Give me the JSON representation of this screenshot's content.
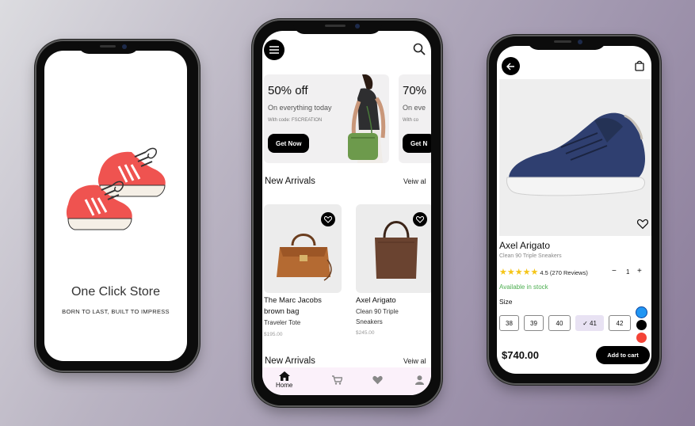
{
  "splash": {
    "store_name": "One Click Store",
    "tagline": "BORN TO LAST, BUILT TO IMPRESS"
  },
  "home": {
    "promos": [
      {
        "title": "50% off",
        "subtitle": "On everything today",
        "code": "With code: FSCREATION",
        "button": "Get Now"
      },
      {
        "title": "70%",
        "subtitle": "On eve",
        "code": "With co",
        "button": "Get N"
      }
    ],
    "section1": {
      "title": "New Arrivals",
      "link": "Veiw al"
    },
    "products": [
      {
        "name": "The Marc Jacobs brown bag",
        "sub": "Traveler Tote",
        "price": "$195.00"
      },
      {
        "name": "Axel Arigato",
        "sub": "Clean 90 Triple Sneakers",
        "price": "$245.00"
      }
    ],
    "section2": {
      "title": "New Arrivals",
      "link": "Veiw al"
    },
    "nav": {
      "home": "Home"
    }
  },
  "detail": {
    "name": "Axel Arigato",
    "subtitle": "Clean 90 Triple Sneakers",
    "rating": "4.5 (270 Reviews)",
    "qty_minus": "−",
    "qty": "1",
    "qty_plus": "+",
    "stock": "Available in stock",
    "size_label": "Size",
    "sizes": [
      "38",
      "39",
      "40",
      "✓ 41",
      "42"
    ],
    "colors": [
      "#2196f3",
      "#000000",
      "#f44336"
    ],
    "price": "$740.00",
    "add_to_cart": "Add to cart"
  }
}
